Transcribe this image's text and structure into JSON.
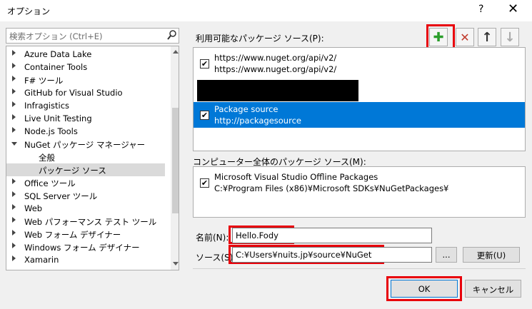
{
  "window": {
    "title": "オプション",
    "help": "?",
    "close": "✕"
  },
  "search": {
    "placeholder": "検索オプション (Ctrl+E)"
  },
  "tree": [
    {
      "label": "Azure Data Lake",
      "state": "collapsed"
    },
    {
      "label": "Container Tools",
      "state": "collapsed"
    },
    {
      "label": "F# ツール",
      "state": "collapsed"
    },
    {
      "label": "GitHub for Visual Studio",
      "state": "collapsed"
    },
    {
      "label": "Infragistics",
      "state": "collapsed"
    },
    {
      "label": "Live Unit Testing",
      "state": "collapsed"
    },
    {
      "label": "Node.js Tools",
      "state": "collapsed"
    },
    {
      "label": "NuGet パッケージ マネージャー",
      "state": "expanded"
    },
    {
      "label": "全般",
      "state": "child"
    },
    {
      "label": "パッケージ ソース",
      "state": "child-selected"
    },
    {
      "label": "Office ツール",
      "state": "collapsed"
    },
    {
      "label": "SQL Server ツール",
      "state": "collapsed"
    },
    {
      "label": "Web",
      "state": "collapsed"
    },
    {
      "label": "Web パフォーマンス テスト ツール",
      "state": "collapsed"
    },
    {
      "label": "Web フォーム デザイナー",
      "state": "collapsed"
    },
    {
      "label": "Windows フォーム デザイナー",
      "state": "collapsed"
    },
    {
      "label": "Xamarin",
      "state": "collapsed"
    }
  ],
  "available_label": "利用可能なパッケージ ソース(P):",
  "toolbar": {
    "add": "✚",
    "remove": "✕",
    "up": "↑",
    "down": "↓"
  },
  "sources": [
    {
      "name": "https://www.nuget.org/api/v2/",
      "url": "https://www.nuget.org/api/v2/",
      "checked": true
    },
    {
      "name": "Package source",
      "url": "http://packagesource",
      "checked": true
    }
  ],
  "machine_label": "コンピューター全体のパッケージ ソース(M):",
  "machine_sources": [
    {
      "name": "Microsoft Visual Studio Offline Packages",
      "url": "C:¥Program Files (x86)¥Microsoft SDKs¥NuGetPackages¥",
      "checked": true
    }
  ],
  "form": {
    "name_label": "名前(N):",
    "name_value": "Hello.Fody",
    "source_label": "ソース(S):",
    "source_value": "C:¥Users¥nuits.jp¥source¥NuGet",
    "browse": "...",
    "update": "更新(U)"
  },
  "footer": {
    "ok": "OK",
    "cancel": "キャンセル"
  },
  "colors": {
    "selection": "#0078d7",
    "highlight_box": "#e8000b",
    "add_icon": "#2a9d2a",
    "remove_icon": "#c0392b"
  }
}
